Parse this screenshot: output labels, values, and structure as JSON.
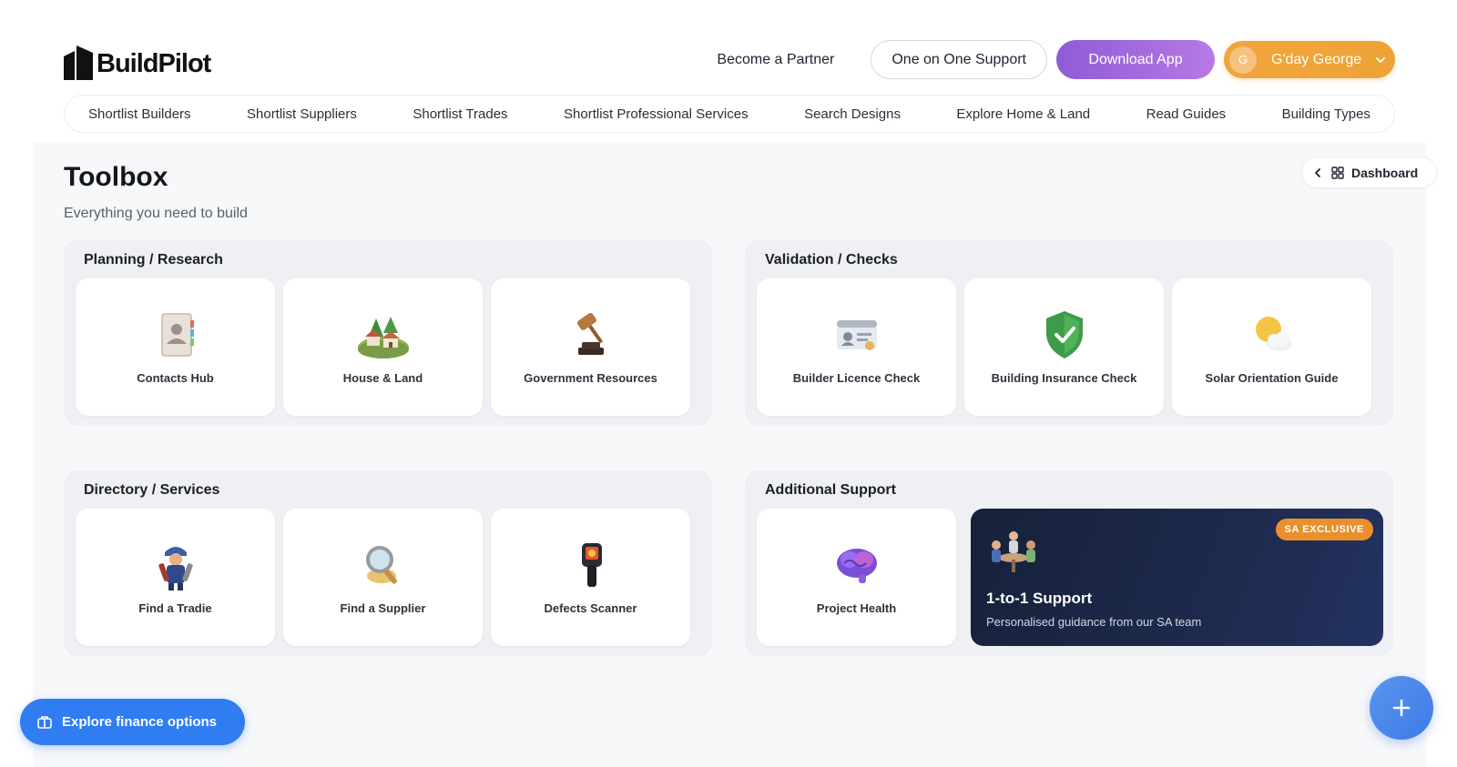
{
  "brand": {
    "name": "BuildPilot"
  },
  "header": {
    "partner_link": "Become a Partner",
    "support_button": "One on One Support",
    "download_button": "Download App",
    "user": {
      "initial": "G",
      "greeting": "G'day George"
    }
  },
  "nav": {
    "items": [
      "Shortlist Builders",
      "Shortlist Suppliers",
      "Shortlist Trades",
      "Shortlist Professional Services",
      "Search Designs",
      "Explore Home & Land",
      "Read Guides",
      "Building Types"
    ]
  },
  "page": {
    "title": "Toolbox",
    "subtitle": "Everything you need to build",
    "dashboard_button": "Dashboard"
  },
  "sections": {
    "planning": {
      "title": "Planning / Research",
      "cards": [
        {
          "label": "Contacts Hub",
          "icon": "contacts-book-icon"
        },
        {
          "label": "House & Land",
          "icon": "houses-landscape-icon"
        },
        {
          "label": "Government Resources",
          "icon": "gavel-icon"
        }
      ]
    },
    "validation": {
      "title": "Validation / Checks",
      "cards": [
        {
          "label": "Builder Licence Check",
          "icon": "id-card-icon"
        },
        {
          "label": "Building Insurance Check",
          "icon": "shield-check-icon"
        },
        {
          "label": "Solar Orientation Guide",
          "icon": "sun-cloud-icon"
        }
      ]
    },
    "directory": {
      "title": "Directory / Services",
      "cards": [
        {
          "label": "Find a Tradie",
          "icon": "tradie-worker-icon"
        },
        {
          "label": "Find a Supplier",
          "icon": "magnifier-icon"
        },
        {
          "label": "Defects Scanner",
          "icon": "thermal-scanner-icon"
        }
      ]
    },
    "support": {
      "title": "Additional Support",
      "card": {
        "label": "Project Health",
        "icon": "brain-icon"
      },
      "promo": {
        "badge": "SA EXCLUSIVE",
        "title": "1-to-1 Support",
        "subtitle": "Personalised guidance from our SA team"
      }
    }
  },
  "footer": {
    "finance_button": "Explore finance options"
  },
  "colors": {
    "accent_purple": "#9b65dc",
    "accent_orange": "#efa336",
    "finance_blue": "#2f7df1",
    "badge_orange": "#e8912c",
    "promo_navy": "#1b2644"
  }
}
